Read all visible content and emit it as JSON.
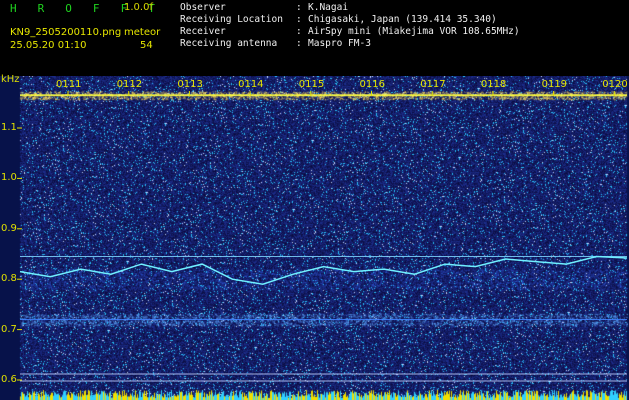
{
  "header": {
    "title": "H R O F F T",
    "version": "1.0.0f",
    "filename": "KN9_2505200110.png",
    "meteor_label": "meteor",
    "timestamp": "25.05.20 01:10",
    "meteor_count": "54"
  },
  "info": [
    {
      "key": "Observer",
      "value": "K.Nagai"
    },
    {
      "key": "Receiving Location",
      "value": "Chigasaki, Japan (139.414 35.340)"
    },
    {
      "key": "Receiver",
      "value": "AirSpy mini (Miakejima VOR 108.65MHz)"
    },
    {
      "key": "Receiving antenna",
      "value": "Maspro FM-3"
    }
  ],
  "chart_data": {
    "type": "heatmap",
    "ylabel": "kHz",
    "y_ticks": [
      "1.1",
      "1.0",
      "0.9",
      "0.8",
      "0.7",
      "0.6"
    ],
    "ylim": [
      0.58,
      1.18
    ],
    "x_ticks": [
      "0111",
      "0112",
      "0113",
      "0114",
      "0115",
      "0116",
      "0117",
      "0118",
      "0119",
      "0120"
    ],
    "lines": [
      {
        "y": 1.165,
        "color": "#ffff40"
      },
      {
        "y": 0.845,
        "color": "#80d8ff"
      },
      {
        "y": 0.72,
        "color": "#4080ff"
      },
      {
        "y": 0.612,
        "color": "#c0d0ff"
      },
      {
        "y": 0.598,
        "color": "#c0d0ff"
      }
    ],
    "trace": {
      "x": [
        0,
        0.05,
        0.1,
        0.15,
        0.2,
        0.25,
        0.3,
        0.35,
        0.4,
        0.45,
        0.5,
        0.55,
        0.6,
        0.65,
        0.7,
        0.75,
        0.8,
        0.85,
        0.9,
        0.95,
        1.0
      ],
      "y": [
        0.815,
        0.805,
        0.82,
        0.81,
        0.83,
        0.815,
        0.83,
        0.8,
        0.79,
        0.81,
        0.825,
        0.815,
        0.82,
        0.81,
        0.83,
        0.825,
        0.84,
        0.835,
        0.83,
        0.845,
        0.842
      ]
    }
  }
}
